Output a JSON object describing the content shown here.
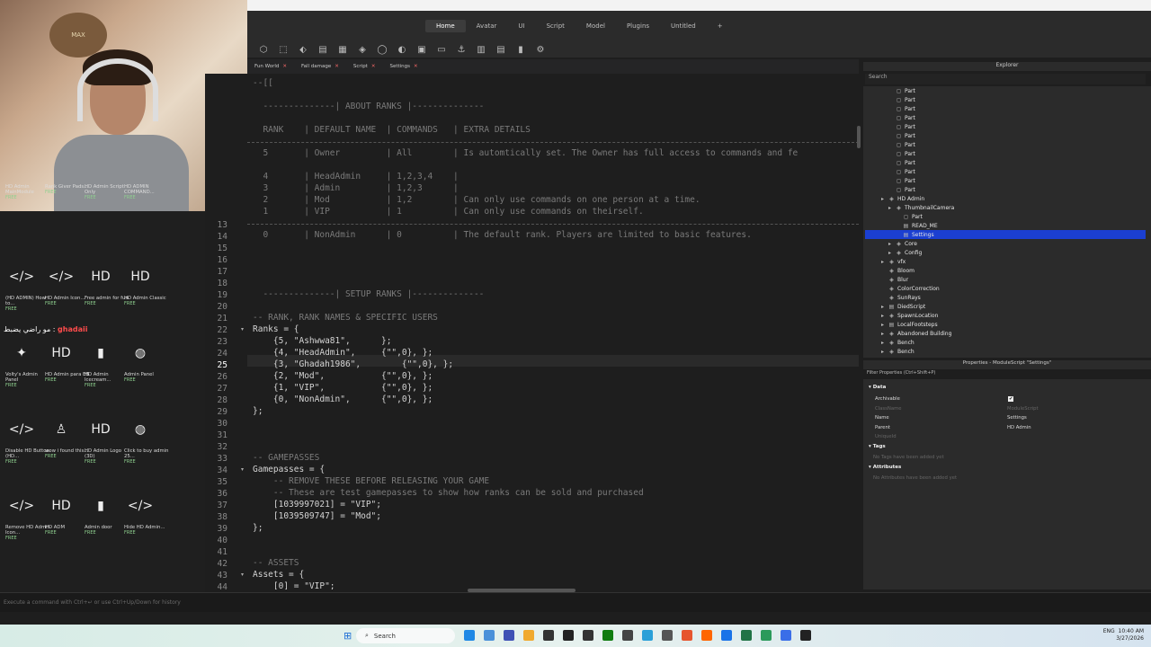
{
  "ribbon": {
    "tabs": [
      "Home",
      "Avatar",
      "UI",
      "Script",
      "Model",
      "Plugins",
      "Untitled",
      "+"
    ],
    "active": "Home"
  },
  "doc_tabs": [
    {
      "label": "Fun World"
    },
    {
      "label": "Fall damage"
    },
    {
      "label": "Script"
    },
    {
      "label": "Settings"
    }
  ],
  "editor": {
    "current_line": "25",
    "top_code": [
      "--[[",
      "",
      "  --------------| ABOUT RANKS |--------------",
      "",
      "  RANK    | DEFAULT NAME  | COMMANDS   | EXTRA DETAILS",
      "  -------------------------------------------------------------------------------------------------------------",
      "  5       | Owner         | All        | Is automtically set. The Owner has full access to commands and fe",
      "",
      "  4       | HeadAdmin     | 1,2,3,4    |",
      "  3       | Admin         | 1,2,3      |",
      "  2       | Mod           | 1,2        | Can only use commands on one person at a time.",
      "  1       | VIP           | 1          | Can only use commands on theirself.",
      "  -------------------------------------------------------------------------------------------------------------",
      "  0       | NonAdmin      | 0          | The default rank. Players are limited to basic features."
    ],
    "lines": [
      {
        "n": "13",
        "text": ""
      },
      {
        "n": "14",
        "text": "  0       | NonAdmin      | 0          | The default rank. Players are limited to basic features."
      },
      {
        "n": "15",
        "text": ""
      },
      {
        "n": "16",
        "text": ""
      },
      {
        "n": "17",
        "text": ""
      },
      {
        "n": "18",
        "text": ""
      },
      {
        "n": "19",
        "text": "  --------------| SETUP RANKS |--------------"
      },
      {
        "n": "20",
        "text": ""
      },
      {
        "n": "21",
        "text": "-- RANK, RANK NAMES & SPECIFIC USERS"
      },
      {
        "n": "22",
        "text": "Ranks = {"
      },
      {
        "n": "23",
        "text": "    {5, \"Ashwwa81\",      };"
      },
      {
        "n": "24",
        "text": "    {4, \"HeadAdmin\",     {\"\",0}, };"
      },
      {
        "n": "25",
        "text": "    {3, \"Ghadah1986\",        {\"\",0}, };"
      },
      {
        "n": "26",
        "text": "    {2, \"Mod\",           {\"\",0}, };"
      },
      {
        "n": "27",
        "text": "    {1, \"VIP\",           {\"\",0}, };"
      },
      {
        "n": "28",
        "text": "    {0, \"NonAdmin\",      {\"\",0}, };"
      },
      {
        "n": "29",
        "text": "};"
      },
      {
        "n": "30",
        "text": ""
      },
      {
        "n": "31",
        "text": ""
      },
      {
        "n": "32",
        "text": ""
      },
      {
        "n": "33",
        "text": "-- GAMEPASSES"
      },
      {
        "n": "34",
        "text": "Gamepasses = {"
      },
      {
        "n": "35",
        "text": "    -- REMOVE THESE BEFORE RELEASING YOUR GAME"
      },
      {
        "n": "36",
        "text": "    -- These are test gamepasses to show how ranks can be sold and purchased"
      },
      {
        "n": "37",
        "text": "    [1039997021] = \"VIP\";"
      },
      {
        "n": "38",
        "text": "    [1039509747] = \"Mod\";"
      },
      {
        "n": "39",
        "text": "};"
      },
      {
        "n": "40",
        "text": ""
      },
      {
        "n": "41",
        "text": ""
      },
      {
        "n": "42",
        "text": "-- ASSETS"
      },
      {
        "n": "43",
        "text": "Assets = {"
      },
      {
        "n": "44",
        "text": "    [0] = \"VIP\";"
      }
    ]
  },
  "toolbox": {
    "items": [
      {
        "label": "HD Admin MainModule",
        "glyph": "</>"
      },
      {
        "label": "Rank Giver Pads...",
        "glyph": "</>"
      },
      {
        "label": "HD Admin Script Only",
        "glyph": "HD"
      },
      {
        "label": "HD ADMIN COMMAND...",
        "glyph": "HD"
      },
      {
        "label": "(HD ADMIN) How to...",
        "glyph": "</>"
      },
      {
        "label": "HD Admin Icon...",
        "glyph": "</>"
      },
      {
        "label": "Free admin for fun",
        "glyph": "HD"
      },
      {
        "label": "HD Admin Classic",
        "glyph": "HD"
      },
      {
        "label": "Volty's Admin Panel",
        "glyph": "✦"
      },
      {
        "label": "HD Admin para EB",
        "glyph": "HD"
      },
      {
        "label": "HD Admin Icecream...",
        "glyph": "▮"
      },
      {
        "label": "Admin Panel",
        "glyph": "◍"
      },
      {
        "label": "Disable HD Button (HD...",
        "glyph": "</>"
      },
      {
        "label": "wow i found this...",
        "glyph": "♙"
      },
      {
        "label": "HD Admin Logo (3D)",
        "glyph": "HD"
      },
      {
        "label": "Click to buy admin 25...",
        "glyph": "◍"
      },
      {
        "label": "Remove HD Admin Icon...",
        "glyph": "</>"
      },
      {
        "label": "HD ADM",
        "glyph": "HD"
      },
      {
        "label": "Admin door",
        "glyph": "▮"
      },
      {
        "label": "Hide HD Admin...",
        "glyph": "</>"
      }
    ],
    "free_label": "FREE"
  },
  "chat": {
    "user": "ghadaii",
    "message": "مو راضي يضبط"
  },
  "webcam": {
    "art_text": "MAX"
  },
  "explorer": {
    "title": "Explorer",
    "search_placeholder": "Search",
    "items": [
      {
        "label": "Part",
        "indent": 2
      },
      {
        "label": "Part",
        "indent": 2
      },
      {
        "label": "Part",
        "indent": 2
      },
      {
        "label": "Part",
        "indent": 2
      },
      {
        "label": "Part",
        "indent": 2
      },
      {
        "label": "Part",
        "indent": 2
      },
      {
        "label": "Part",
        "indent": 2
      },
      {
        "label": "Part",
        "indent": 2
      },
      {
        "label": "Part",
        "indent": 2
      },
      {
        "label": "Part",
        "indent": 2
      },
      {
        "label": "Part",
        "indent": 2
      },
      {
        "label": "Part",
        "indent": 2
      },
      {
        "label": "HD Admin",
        "indent": 1
      },
      {
        "label": "ThumbnailCamera",
        "indent": 2
      },
      {
        "label": "Part",
        "indent": 3
      },
      {
        "label": "READ_ME",
        "indent": 3
      },
      {
        "label": "Settings",
        "indent": 3,
        "selected": true
      },
      {
        "label": "Core",
        "indent": 2
      },
      {
        "label": "Config",
        "indent": 2
      },
      {
        "label": "vfx",
        "indent": 1
      },
      {
        "label": "Bloom",
        "indent": 1
      },
      {
        "label": "Blur",
        "indent": 1
      },
      {
        "label": "ColorCorrection",
        "indent": 1
      },
      {
        "label": "SunRays",
        "indent": 1
      },
      {
        "label": "DiedScript",
        "indent": 1
      },
      {
        "label": "SpawnLocation",
        "indent": 1
      },
      {
        "label": "LocalFootsteps",
        "indent": 1
      },
      {
        "label": "Abandoned Building",
        "indent": 1
      },
      {
        "label": "Bench",
        "indent": 1
      },
      {
        "label": "Bench",
        "indent": 1
      }
    ]
  },
  "properties": {
    "title": "Properties - ModuleScript \"Settings\"",
    "filter_placeholder": "Filter Properties (Ctrl+Shift+P)",
    "section_data": "Data",
    "rows": [
      {
        "name": "Archivable",
        "value": "✔",
        "muted": false
      },
      {
        "name": "ClassName",
        "value": "ModuleScript",
        "muted": true
      },
      {
        "name": "Name",
        "value": "Settings",
        "muted": false
      },
      {
        "name": "Parent",
        "value": "HD Admin",
        "muted": false
      },
      {
        "name": "UniqueId",
        "value": "",
        "muted": true
      }
    ],
    "section_tags": "Tags",
    "tags_empty": "No Tags have been added yet",
    "section_attributes": "Attributes",
    "attributes_empty": "No Attributes have been added yet"
  },
  "cmdbar": {
    "placeholder": "Execute a command with Ctrl+↵ or use Ctrl+Up/Down for history"
  },
  "taskbar": {
    "search_label": "Search",
    "time": "10:40 AM",
    "date": "3/27/2026",
    "lang": "ENG"
  },
  "colors": {
    "accent": "#1b3fd1",
    "editor_bg": "#1e1e1e",
    "panel_bg": "#2b2b2b"
  }
}
